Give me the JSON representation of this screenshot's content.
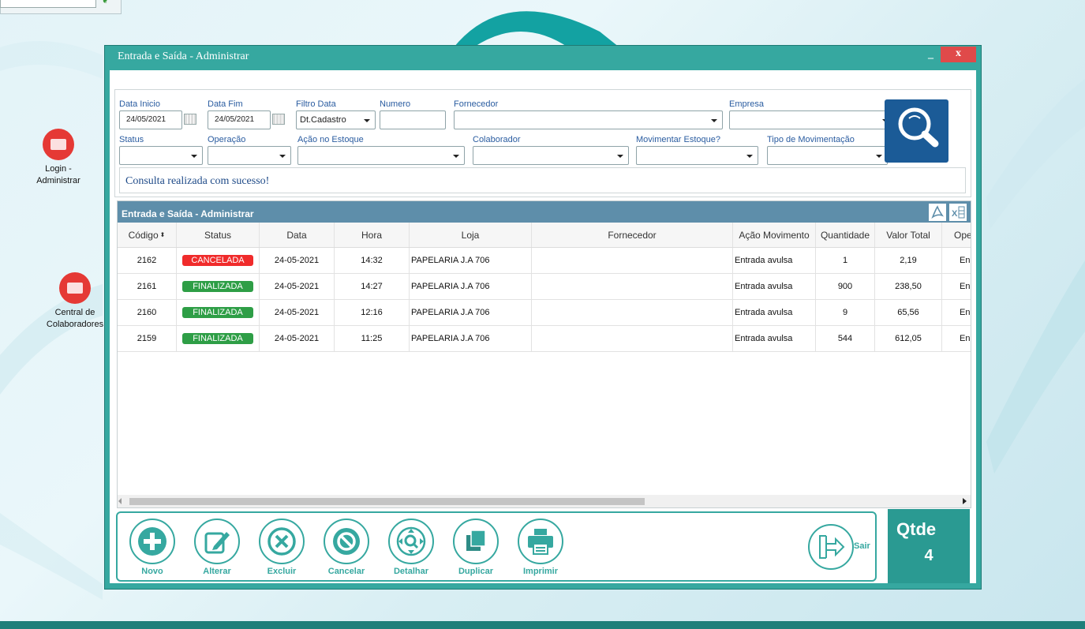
{
  "desktop": {
    "icons": [
      {
        "label_line1": "Login -",
        "label_line2": "Administrar"
      },
      {
        "label_line1": "Central de",
        "label_line2": "Colaboradores"
      }
    ]
  },
  "window": {
    "title": "Entrada e Saída - Administrar",
    "minimize_label": "–",
    "close_label": "x",
    "colors": {
      "frame": "#36a8a0",
      "accent": "#1b5b97",
      "close": "#e04a4a"
    }
  },
  "filters": {
    "data_inicio": {
      "label": "Data Inicio",
      "value": "24/05/2021"
    },
    "data_fim": {
      "label": "Data Fim",
      "value": "24/05/2021"
    },
    "filtro_data": {
      "label": "Filtro Data",
      "value": "Dt.Cadastro"
    },
    "numero": {
      "label": "Numero",
      "value": ""
    },
    "fornecedor": {
      "label": "Fornecedor",
      "value": ""
    },
    "empresa": {
      "label": "Empresa",
      "value": ""
    },
    "status": {
      "label": "Status",
      "value": ""
    },
    "operacao": {
      "label": "Operação",
      "value": ""
    },
    "acao_estoque": {
      "label": "Ação no Estoque",
      "value": ""
    },
    "colaborador": {
      "label": "Colaborador",
      "value": ""
    },
    "movimentar_estoque": {
      "label": "Movimentar Estoque?",
      "value": ""
    },
    "tipo_movimentacao": {
      "label": "Tipo de Movimentação",
      "value": ""
    },
    "message": "Consulta realizada com sucesso!"
  },
  "grid": {
    "caption": "Entrada e Saída - Administrar",
    "columns": [
      "Código",
      "Status",
      "Data",
      "Hora",
      "Loja",
      "Fornecedor",
      "Ação Movimento",
      "Quantidade",
      "Valor Total",
      "Ope"
    ],
    "rows": [
      {
        "codigo": "2162",
        "status": "CANCELADA",
        "status_color": "#f02b2b",
        "data": "24-05-2021",
        "hora": "14:32",
        "loja": "PAPELARIA J.A 706",
        "fornecedor": "",
        "acao": "Entrada avulsa",
        "quantidade": "1",
        "valor": "2,19",
        "ope": "En"
      },
      {
        "codigo": "2161",
        "status": "FINALIZADA",
        "status_color": "#2e9e46",
        "data": "24-05-2021",
        "hora": "14:27",
        "loja": "PAPELARIA J.A 706",
        "fornecedor": "",
        "acao": "Entrada avulsa",
        "quantidade": "900",
        "valor": "238,50",
        "ope": "En"
      },
      {
        "codigo": "2160",
        "status": "FINALIZADA",
        "status_color": "#2e9e46",
        "data": "24-05-2021",
        "hora": "12:16",
        "loja": "PAPELARIA J.A 706",
        "fornecedor": "",
        "acao": "Entrada avulsa",
        "quantidade": "9",
        "valor": "65,56",
        "ope": "En"
      },
      {
        "codigo": "2159",
        "status": "FINALIZADA",
        "status_color": "#2e9e46",
        "data": "24-05-2021",
        "hora": "11:25",
        "loja": "PAPELARIA J.A 706",
        "fornecedor": "",
        "acao": "Entrada avulsa",
        "quantidade": "544",
        "valor": "612,05",
        "ope": "En"
      }
    ]
  },
  "actions": {
    "novo": "Novo",
    "alterar": "Alterar",
    "excluir": "Excluir",
    "cancelar": "Cancelar",
    "detalhar": "Detalhar",
    "duplicar": "Duplicar",
    "imprimir": "Imprimir",
    "sair": "Sair"
  },
  "qtde": {
    "label": "Qtde",
    "value": "4"
  }
}
